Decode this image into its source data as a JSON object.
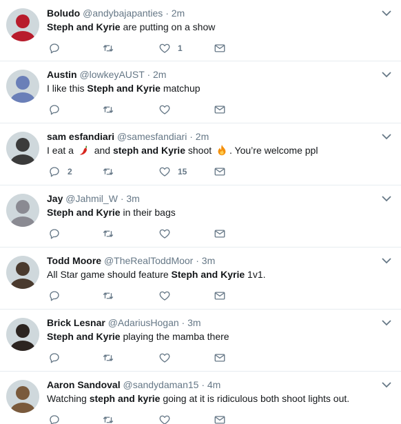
{
  "tweets": [
    {
      "name": "Boludo",
      "handle": "@andybajapanties",
      "time": "2m",
      "parts": [
        {
          "t": "b",
          "v": "Steph and Kyrie"
        },
        {
          "t": "s",
          "v": " are putting on a show"
        }
      ],
      "counts": {
        "reply": "",
        "retweet": "",
        "like": "1"
      },
      "avatar_color": "#b81c2c"
    },
    {
      "name": "Austin",
      "handle": "@lowkeyAUST",
      "time": "2m",
      "parts": [
        {
          "t": "s",
          "v": "I like this "
        },
        {
          "t": "b",
          "v": "Steph and Kyrie"
        },
        {
          "t": "s",
          "v": " matchup"
        }
      ],
      "counts": {
        "reply": "",
        "retweet": "",
        "like": ""
      },
      "avatar_color": "#6a7fb8"
    },
    {
      "name": "sam esfandiari",
      "handle": "@samesfandiari",
      "time": "2m",
      "parts": [
        {
          "t": "s",
          "v": "I eat a "
        },
        {
          "t": "e",
          "v": "hot-pepper-emoji"
        },
        {
          "t": "s",
          "v": " and "
        },
        {
          "t": "b",
          "v": "steph and Kyrie"
        },
        {
          "t": "s",
          "v": " shoot "
        },
        {
          "t": "e",
          "v": "fire-emoji"
        },
        {
          "t": "s",
          "v": ". You’re welcome ppl"
        }
      ],
      "counts": {
        "reply": "2",
        "retweet": "",
        "like": "15"
      },
      "avatar_color": "#3b3b3b"
    },
    {
      "name": "Jay",
      "handle": "@Jahmil_W",
      "time": "3m",
      "parts": [
        {
          "t": "b",
          "v": "Steph and Kyrie"
        },
        {
          "t": "s",
          "v": " in their bags"
        }
      ],
      "counts": {
        "reply": "",
        "retweet": "",
        "like": ""
      },
      "avatar_color": "#8a8a92"
    },
    {
      "name": "Todd Moore",
      "handle": "@TheRealToddMoor",
      "time": "3m",
      "parts": [
        {
          "t": "s",
          "v": "All Star game should feature "
        },
        {
          "t": "b",
          "v": "Steph and Kyrie"
        },
        {
          "t": "s",
          "v": " 1v1."
        }
      ],
      "counts": {
        "reply": "",
        "retweet": "",
        "like": ""
      },
      "avatar_color": "#4a3a2e"
    },
    {
      "name": "Brick Lesnar",
      "handle": "@AdariusHogan",
      "time": "3m",
      "parts": [
        {
          "t": "b",
          "v": "Steph and Kyrie"
        },
        {
          "t": "s",
          "v": " playing the mamba there"
        }
      ],
      "counts": {
        "reply": "",
        "retweet": "",
        "like": ""
      },
      "avatar_color": "#2c2420"
    },
    {
      "name": "Aaron Sandoval",
      "handle": "@sandydaman15",
      "time": "4m",
      "parts": [
        {
          "t": "s",
          "v": "Watching "
        },
        {
          "t": "b",
          "v": "steph and kyrie"
        },
        {
          "t": "s",
          "v": " going at it is ridiculous  both shoot lights out."
        }
      ],
      "counts": {
        "reply": "",
        "retweet": "",
        "like": ""
      },
      "avatar_color": "#7a5a3c"
    }
  ],
  "ui": {
    "dot": "·",
    "icon_color": "#657786"
  }
}
